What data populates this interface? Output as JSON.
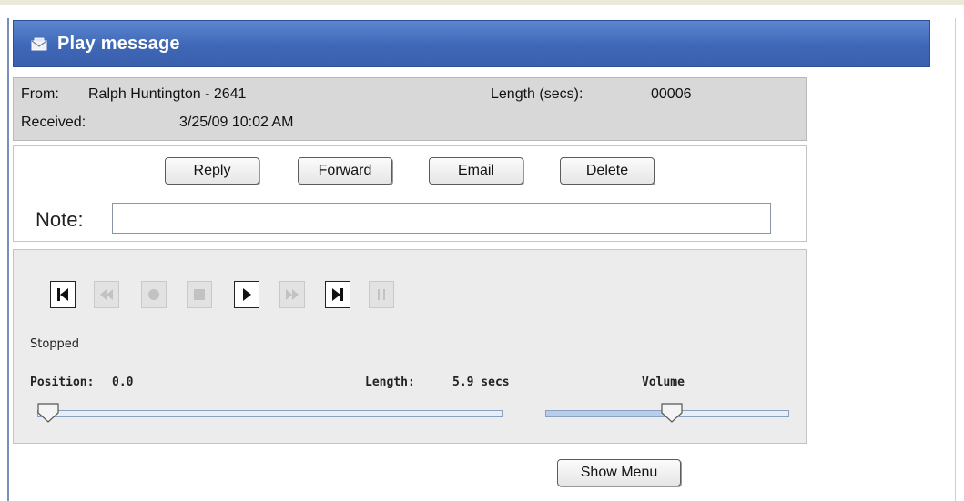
{
  "header": {
    "title": "Play message",
    "icon": "envelope-icon"
  },
  "message": {
    "from_label": "From:",
    "from_value": "Ralph Huntington - 2641",
    "length_label": "Length (secs):",
    "length_value": "00006",
    "received_label": "Received:",
    "received_value": "3/25/09 10:02 AM"
  },
  "actions": {
    "reply": "Reply",
    "forward": "Forward",
    "email": "Email",
    "delete": "Delete"
  },
  "note": {
    "label": "Note:",
    "value": "",
    "placeholder": ""
  },
  "player": {
    "controls": [
      {
        "icon": "skip-to-start-icon",
        "enabled": true
      },
      {
        "icon": "rewind-icon",
        "enabled": false
      },
      {
        "icon": "record-icon",
        "enabled": false
      },
      {
        "icon": "stop-icon",
        "enabled": false
      },
      {
        "icon": "play-icon",
        "enabled": true
      },
      {
        "icon": "fast-forward-icon",
        "enabled": false
      },
      {
        "icon": "skip-to-end-icon",
        "enabled": true
      },
      {
        "icon": "pause-icon",
        "enabled": false
      }
    ],
    "status": "Stopped",
    "position_label": "Position:",
    "position_value": "0.0",
    "length_label": "Length:",
    "length_value": "5.9 secs",
    "volume_label": "Volume",
    "position_fraction": 0.0,
    "volume_fraction": 0.52
  },
  "footer": {
    "show_menu": "Show Menu"
  },
  "colors": {
    "header": "#3e67b6",
    "info_bg": "#d8d8d8",
    "player_bg": "#ececec"
  }
}
